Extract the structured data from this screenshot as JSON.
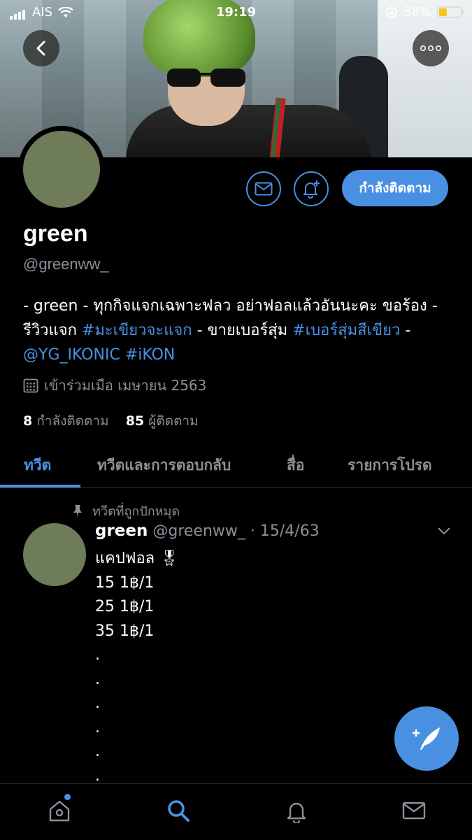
{
  "status_bar": {
    "carrier": "AIS",
    "time": "19:19",
    "battery": "38%",
    "battery_level": 0.38
  },
  "profile": {
    "name": "green",
    "handle": "@greenww_",
    "bio_parts": [
      {
        "text": "- green - ทุกกิจแจกเฉพาะฟลว อย่าฟอลแล้วอันนะคะ ขอร้อง - รีวิวแจก ",
        "link": false
      },
      {
        "text": "#มะเขียวจะแจก",
        "link": true
      },
      {
        "text": " - ขายเบอร์สุ่ม ",
        "link": false
      },
      {
        "text": "#เบอร์สุ่มสีเขียว",
        "link": true
      },
      {
        "text": " - ",
        "link": false
      },
      {
        "text": "@YG_IKONIC",
        "link": true
      },
      {
        "text": " ",
        "link": false
      },
      {
        "text": "#iKON",
        "link": true
      }
    ],
    "joined": "เข้าร่วมเมือ เมษายน 2563",
    "following_count": "8",
    "following_label": "กำลังติดตาม",
    "followers_count": "85",
    "followers_label": "ผู้ติดตาม",
    "follow_button": "กำลังติดตาม"
  },
  "tabs": [
    "ทวีต",
    "ทวีตและการตอบกลับ",
    "สื่อ",
    "รายการโปรด"
  ],
  "tweet": {
    "pinned_label": "ทวีตที่ถูกปักหมุด",
    "name": "green",
    "handle_date": "@greenww_ · 15/4/63",
    "lines": [
      "แคปฟอล 🎖",
      "15 1฿/1",
      "25 1฿/1",
      "35 1฿/1",
      ".",
      ".",
      ".",
      ".",
      ".",
      "."
    ]
  },
  "colors": {
    "accent": "#4a90e2",
    "background": "#000000",
    "muted": "#8a9199"
  }
}
